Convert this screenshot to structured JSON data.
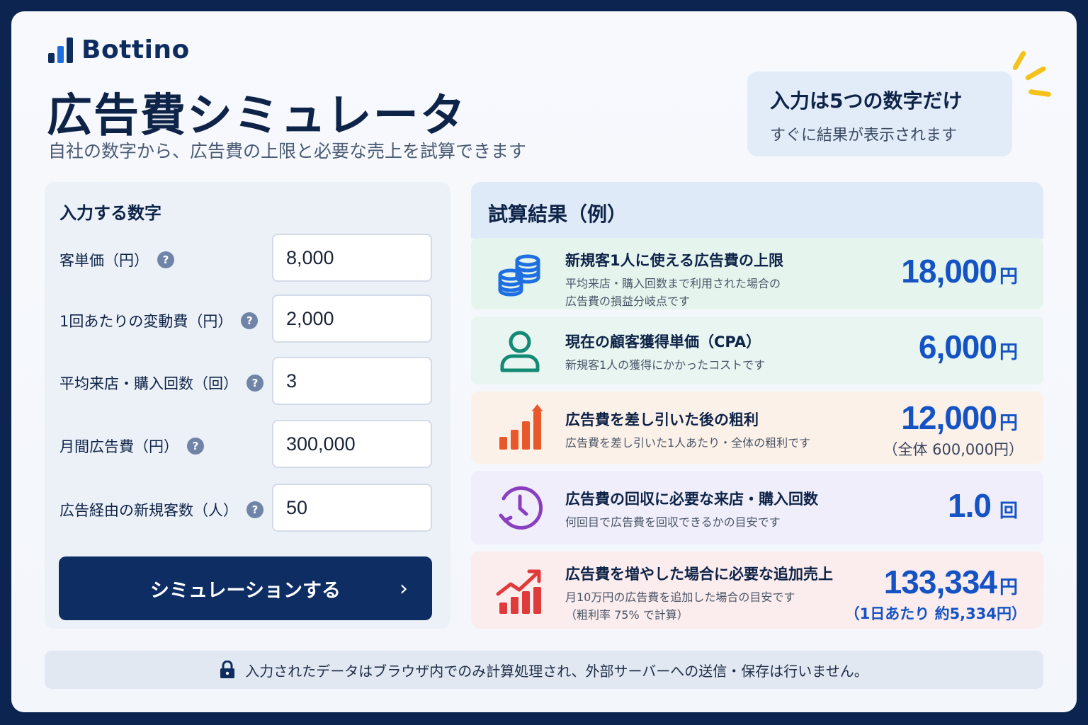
{
  "brand": {
    "name": "Bottino"
  },
  "header": {
    "title": "広告費シミュレータ",
    "subtitle": "自社の数字から、広告費の上限と必要な売上を試算できます"
  },
  "callout": {
    "title": "入力は5つの数字だけ",
    "subtitle": "すぐに結果が表示されます"
  },
  "inputs": {
    "panel_title": "入力する数字",
    "fields": [
      {
        "label": "客単価（円）",
        "value": "8,000"
      },
      {
        "label": "1回あたりの変動費（円）",
        "value": "2,000"
      },
      {
        "label": "平均来店・購入回数（回）",
        "value": "3"
      },
      {
        "label": "月間広告費（円）",
        "value": "300,000"
      },
      {
        "label": "広告経由の新規客数（人）",
        "value": "50"
      }
    ],
    "help_glyph": "?",
    "button_label": "シミュレーションする",
    "button_chevron": "›"
  },
  "results": {
    "panel_title": "試算結果（例）",
    "items": [
      {
        "title": "新規客1人に使える広告費の上限",
        "desc1": "平均来店・購入回数まで利用された場合の",
        "desc2": "広告費の損益分岐点です",
        "value": "18,000",
        "unit": "円",
        "extra": "",
        "icon": "coins-icon",
        "bg": "#e6f4ee"
      },
      {
        "title": "現在の顧客獲得単価（CPA）",
        "desc1": "新規客1人の獲得にかかったコストです",
        "desc2": "",
        "value": "6,000",
        "unit": "円",
        "extra": "",
        "icon": "user-icon",
        "bg": "#e8f5f1"
      },
      {
        "title": "広告費を差し引いた後の粗利",
        "desc1": "広告費を差し引いた1人あたり・全体の粗利です",
        "desc2": "",
        "value": "12,000",
        "unit": "円",
        "extra": "（全体 600,000円）",
        "icon": "bar-chart-icon",
        "bg": "#fcf1e8"
      },
      {
        "title": "広告費の回収に必要な来店・購入回数",
        "desc1": "何回目で広告費を回収できるかの目安です",
        "desc2": "",
        "value": "1.0",
        "unit": "回",
        "extra": "",
        "icon": "clock-icon",
        "bg": "#efeefa"
      },
      {
        "title": "広告費を増やした場合に必要な追加売上",
        "desc1": "月10万円の広告費を追加した場合の目安です",
        "desc2": "（粗利率 75% で計算）",
        "value": "133,334",
        "unit": "円",
        "extra": "（1日あたり 約5,334円）",
        "icon": "growth-chart-icon",
        "bg": "#fbeced"
      }
    ]
  },
  "footer": {
    "text": "入力されたデータはブラウザ内でのみ計算処理され、外部サーバーへの送信・保存は行いません。"
  },
  "colors": {
    "navy": "#0d2d63",
    "accent_blue": "#1553c4",
    "coins": "#1f6fe0",
    "user": "#138a74",
    "bar": "#e8582a",
    "clock": "#8a3fc0",
    "growth": "#e03a3a"
  }
}
